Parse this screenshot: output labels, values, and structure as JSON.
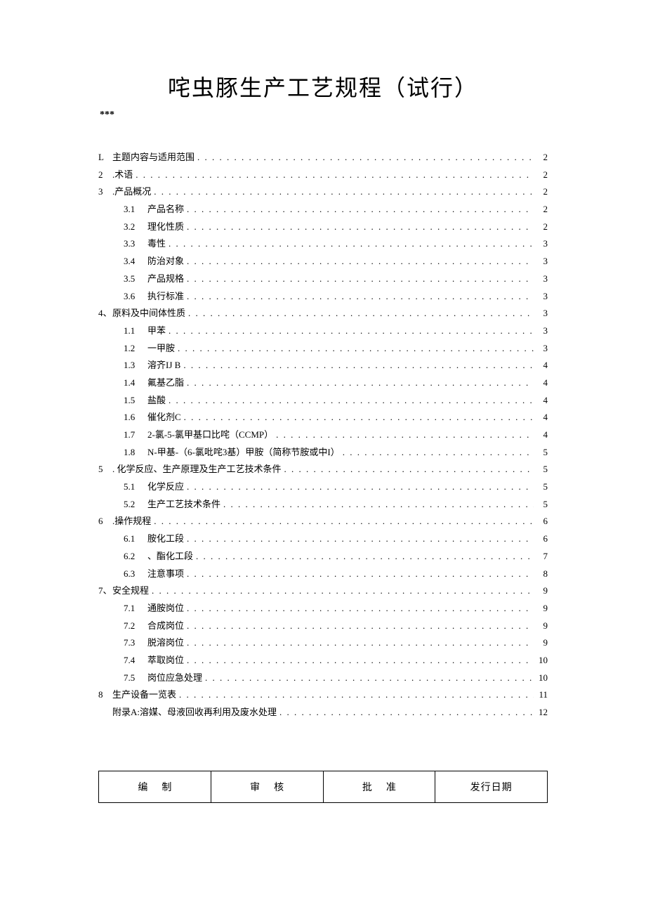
{
  "title": "咤虫豚生产工艺规程（试行）",
  "subtitle": "***",
  "toc": [
    {
      "level": 1,
      "num": "L",
      "label": "主题内容与适用范围",
      "page": "2"
    },
    {
      "level": 1,
      "num": "2",
      "label": ".术语",
      "page": "2"
    },
    {
      "level": 1,
      "num": "3",
      "label": ".产品概况",
      "page": "2"
    },
    {
      "level": 2,
      "num": "3.1",
      "label": "产品名称",
      "page": "2"
    },
    {
      "level": 2,
      "num": "3.2",
      "label": "理化性质",
      "page": "2"
    },
    {
      "level": 2,
      "num": "3.3",
      "label": "毒性",
      "page": "3"
    },
    {
      "level": 2,
      "num": "3.4",
      "label": "防治对象",
      "page": "3"
    },
    {
      "level": 2,
      "num": "3.5",
      "label": "产品规格",
      "page": "3"
    },
    {
      "level": 2,
      "num": "3.6",
      "label": "执行标准",
      "page": "3"
    },
    {
      "level": 1,
      "num": "4、",
      "label": "原料及中间体性质",
      "page": "3"
    },
    {
      "level": 2,
      "num": "1.1",
      "label": "甲苯",
      "page": "3"
    },
    {
      "level": 2,
      "num": "1.2",
      "label": "一甲胺",
      "page": "3"
    },
    {
      "level": 2,
      "num": "1.3",
      "label": "溶齐IJ B",
      "page": "4"
    },
    {
      "level": 2,
      "num": "1.4",
      "label": "氟基乙脂",
      "page": "4"
    },
    {
      "level": 2,
      "num": "1.5",
      "label": "盐酸",
      "page": "4"
    },
    {
      "level": 2,
      "num": "1.6",
      "label": "催化剂C",
      "page": "4"
    },
    {
      "level": 2,
      "num": "1.7",
      "label": "2-氯-5-氯甲基口比咤（CCMP）",
      "page": "4"
    },
    {
      "level": 2,
      "num": "1.8",
      "label": "N-甲基-（6-氯吡咤3基）甲胺（简称节胺或中I）",
      "page": "5"
    },
    {
      "level": 1,
      "num": "5",
      "label": ". 化学反应、生产原理及生产工艺技术条件",
      "page": "5"
    },
    {
      "level": 2,
      "num": "5.1",
      "label": "化学反应",
      "page": "5"
    },
    {
      "level": 2,
      "num": "5.2",
      "label": "生产工艺技术条件",
      "page": "5"
    },
    {
      "level": 1,
      "num": "6",
      "label": ".操作规程",
      "page": "6"
    },
    {
      "level": 2,
      "num": "6.1",
      "label": "胺化工段",
      "page": "6"
    },
    {
      "level": 2,
      "num": "6.2",
      "label": "、酯化工段",
      "page": "7"
    },
    {
      "level": 2,
      "num": "6.3",
      "label": "注意事项",
      "page": "8"
    },
    {
      "level": 1,
      "num": "7、",
      "label": "安全规程",
      "page": "9"
    },
    {
      "level": 2,
      "num": "7.1",
      "label": "通胺岗位",
      "page": "9"
    },
    {
      "level": 2,
      "num": "7.2",
      "label": "合成岗位",
      "page": "9"
    },
    {
      "level": 2,
      "num": "7.3",
      "label": "脱溶岗位",
      "page": "9"
    },
    {
      "level": 2,
      "num": "7.4",
      "label": "萃取岗位",
      "page": "10"
    },
    {
      "level": 2,
      "num": "7.5",
      "label": "岗位应急处理",
      "page": "10"
    },
    {
      "level": 1,
      "num": "8",
      "label": "生产设备一览表",
      "page": "11"
    },
    {
      "level": 1,
      "num": "",
      "label": "附录A:溶媒、母液回收再利用及废水处理",
      "page": "12"
    }
  ],
  "footer": {
    "col1": "编制",
    "col2": "审核",
    "col3": "批准",
    "col4": "发行日期"
  }
}
